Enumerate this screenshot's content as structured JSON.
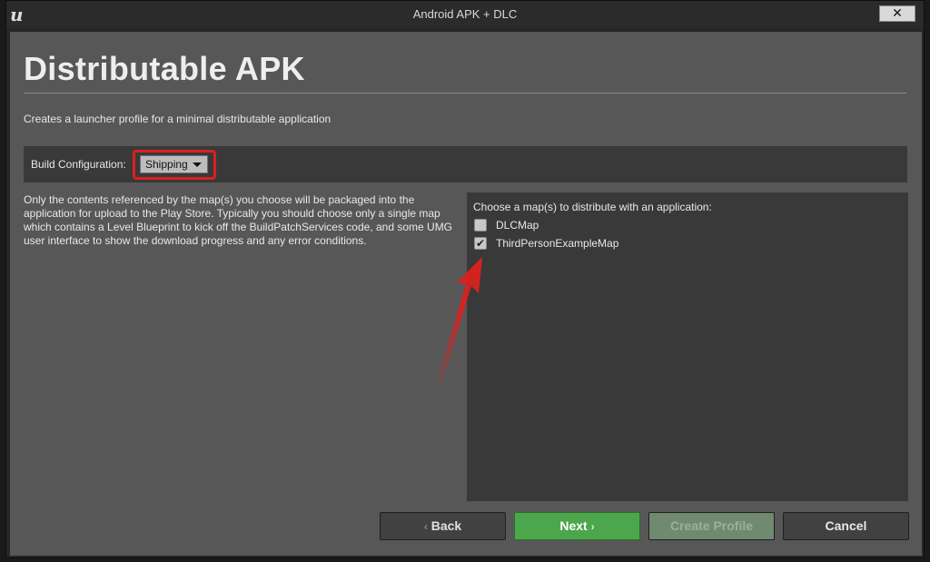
{
  "window": {
    "title": "Android APK + DLC",
    "close_label": "✕"
  },
  "page": {
    "heading": "Distributable APK",
    "subtitle": "Creates a launcher profile for a minimal distributable application"
  },
  "build_config": {
    "label": "Build Configuration:",
    "value": "Shipping"
  },
  "description": "Only the contents referenced by the map(s) you choose will be packaged into the application for upload to the Play Store. Typically you should choose only a single map which contains a Level Blueprint to kick off the BuildPatchServices code, and some UMG user interface to show the download progress and any error conditions.",
  "map_panel": {
    "label": "Choose a map(s) to distribute with an application:",
    "maps": [
      {
        "name": "DLCMap",
        "checked": false
      },
      {
        "name": "ThirdPersonExampleMap",
        "checked": true
      }
    ]
  },
  "buttons": {
    "back": "Back",
    "next": "Next",
    "create": "Create Profile",
    "cancel": "Cancel"
  },
  "colors": {
    "highlight": "#d9211e",
    "next_button": "#4ca64c"
  }
}
